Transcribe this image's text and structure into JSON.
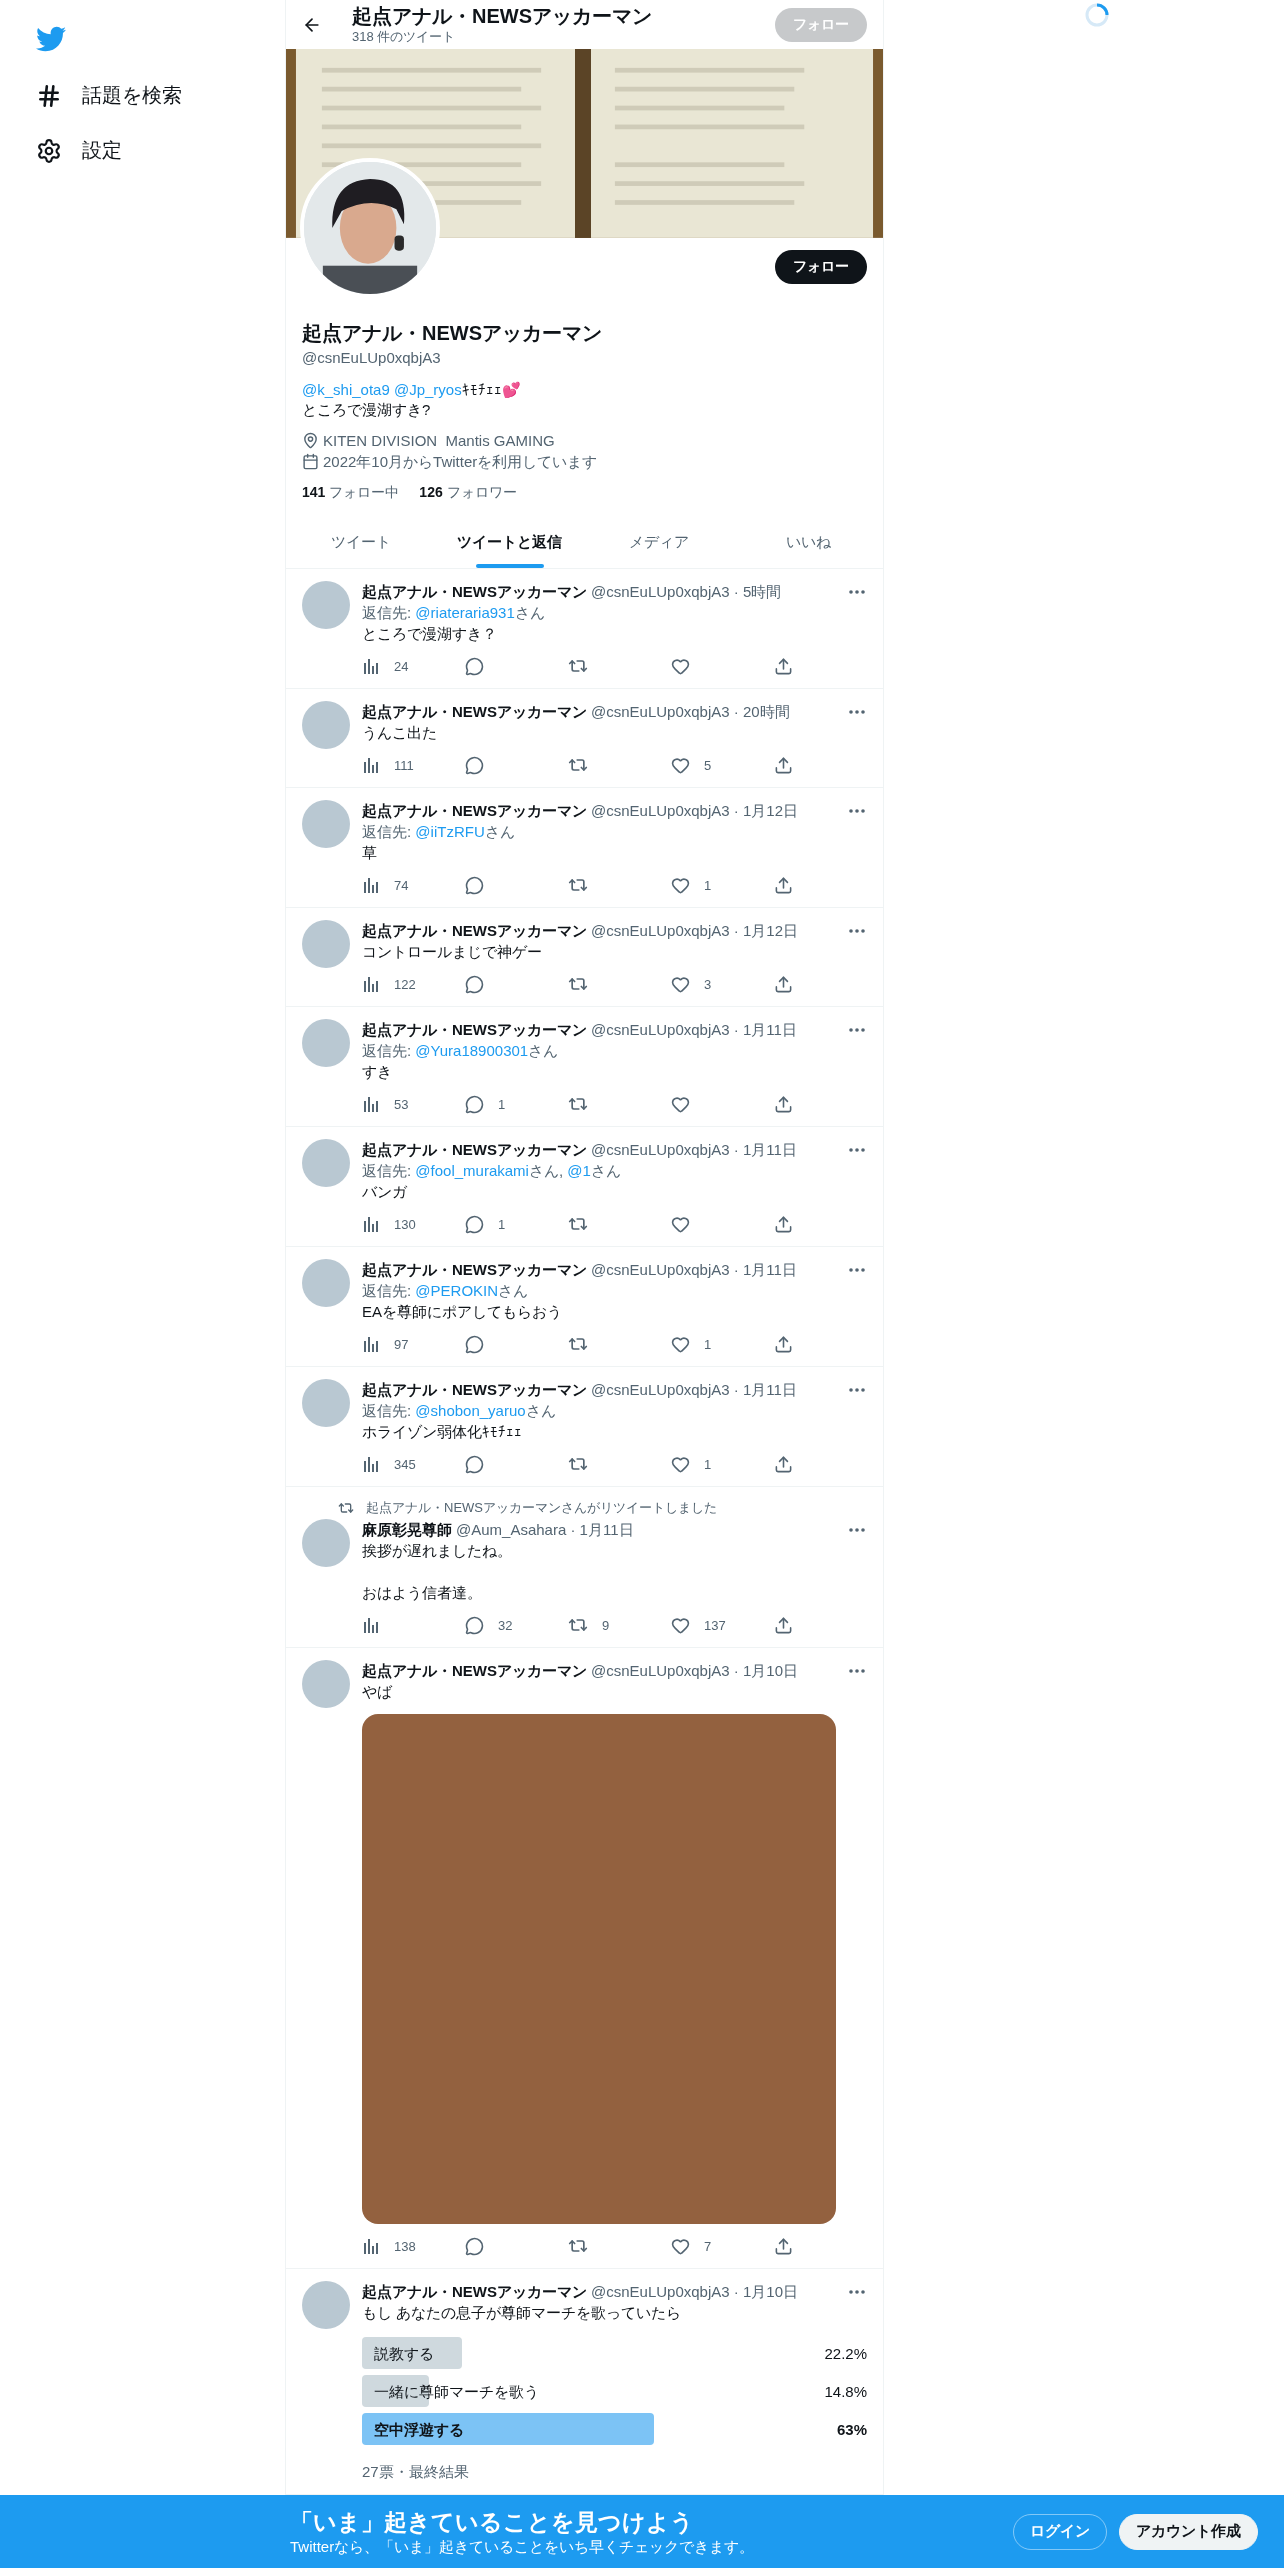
{
  "sidebar": {
    "items": [
      {
        "kind": "explore",
        "label": "話題を検索"
      },
      {
        "kind": "settings",
        "label": "設定"
      }
    ]
  },
  "header": {
    "title": "起点アナル・NEWSアッカーマン",
    "subtitle": "318 件のツイート",
    "follow_button": {
      "label": "フォロー",
      "disabled": true
    }
  },
  "profile": {
    "follow_button": {
      "label": "フォロー",
      "disabled": false
    },
    "name": "起点アナル・NEWSアッカーマン",
    "handle": "@csnEuLUp0xqbjA3",
    "bio": [
      [
        {
          "kind": "mention",
          "text": "@k_shi_ota9"
        },
        {
          "kind": "mention",
          "text": "@Jp_ryos"
        },
        {
          "kind": "text",
          "text": "ｷﾓﾁｪｪ💕"
        }
      ],
      [
        {
          "kind": "text",
          "text": "ところで漫湖すき?"
        }
      ]
    ],
    "location": "KITEN DIVISION  Mantis GAMING",
    "joined": "2022年10月からTwitterを利用しています",
    "stats": [
      {
        "count": "141",
        "label": "フォロー中"
      },
      {
        "count": "126",
        "label": "フォロワー"
      }
    ]
  },
  "tabs": [
    {
      "label": "ツイート",
      "selected": false
    },
    {
      "label": "ツイートと返信",
      "selected": true
    },
    {
      "label": "メディア",
      "selected": false
    },
    {
      "label": "いいね",
      "selected": false
    }
  ],
  "tweets": [
    {
      "author": "起点アナル・NEWSアッカーマン",
      "meta": "@csnEuLUp0xqbjA3 · 5時間",
      "reply_to": [
        {
          "kind": "text",
          "text": "返信先: "
        },
        {
          "kind": "mention",
          "text": "@riateraria931"
        },
        {
          "kind": "text",
          "text": "さん"
        }
      ],
      "text": "ところで漫湖すき？",
      "stats": {
        "views": "24"
      }
    },
    {
      "author": "起点アナル・NEWSアッカーマン",
      "meta": "@csnEuLUp0xqbjA3 · 20時間",
      "text": "うんこ出た",
      "stats": {
        "views": "111",
        "likes": "5"
      }
    },
    {
      "author": "起点アナル・NEWSアッカーマン",
      "meta": "@csnEuLUp0xqbjA3 · 1月12日",
      "reply_to": [
        {
          "kind": "text",
          "text": "返信先: "
        },
        {
          "kind": "mention",
          "text": "@iiTzRFU"
        },
        {
          "kind": "text",
          "text": "さん"
        }
      ],
      "text": "草",
      "stats": {
        "views": "74",
        "likes": "1"
      }
    },
    {
      "author": "起点アナル・NEWSアッカーマン",
      "meta": "@csnEuLUp0xqbjA3 · 1月12日",
      "text": "コントロールまじで神ゲー",
      "stats": {
        "views": "122",
        "likes": "3"
      }
    },
    {
      "author": "起点アナル・NEWSアッカーマン",
      "meta": "@csnEuLUp0xqbjA3 · 1月11日",
      "reply_to": [
        {
          "kind": "text",
          "text": "返信先: "
        },
        {
          "kind": "mention",
          "text": "@Yura18900301"
        },
        {
          "kind": "text",
          "text": "さん"
        }
      ],
      "text": "すき",
      "stats": {
        "views": "53",
        "replies": "1"
      }
    },
    {
      "author": "起点アナル・NEWSアッカーマン",
      "meta": "@csnEuLUp0xqbjA3 · 1月11日",
      "reply_to": [
        {
          "kind": "text",
          "text": "返信先: "
        },
        {
          "kind": "mention",
          "text": "@fool_murakami"
        },
        {
          "kind": "text",
          "text": "さん, "
        },
        {
          "kind": "mention",
          "text": "@1"
        },
        {
          "kind": "text",
          "text": "さん"
        }
      ],
      "text": "バンガ",
      "stats": {
        "views": "130",
        "replies": "1"
      }
    },
    {
      "author": "起点アナル・NEWSアッカーマン",
      "meta": "@csnEuLUp0xqbjA3 · 1月11日",
      "reply_to": [
        {
          "kind": "text",
          "text": "返信先: "
        },
        {
          "kind": "mention",
          "text": "@PEROKIN"
        },
        {
          "kind": "text",
          "text": "さん"
        }
      ],
      "text": "EAを尊師にポアしてもらおう",
      "stats": {
        "views": "97",
        "likes": "1"
      }
    },
    {
      "author": "起点アナル・NEWSアッカーマン",
      "meta": "@csnEuLUp0xqbjA3 · 1月11日",
      "reply_to": [
        {
          "kind": "text",
          "text": "返信先: "
        },
        {
          "kind": "mention",
          "text": "@shobon_yaruo"
        },
        {
          "kind": "text",
          "text": "さん"
        }
      ],
      "text": "ホライゾン弱体化ｷﾓﾁｪｪ",
      "stats": {
        "views": "345",
        "likes": "1"
      }
    },
    {
      "retweeted_by": "起点アナル・NEWSアッカーマンさんがリツイートしました",
      "author": "麻原彰晃尊師",
      "meta": "@Aum_Asahara · 1月11日",
      "text": "挨拶が遅れましたね。",
      "text_2": "おはよう信者達。",
      "stats": {
        "replies": "32",
        "retweets": "9",
        "likes": "137"
      }
    },
    {
      "author": "起点アナル・NEWSアッカーマン",
      "meta": "@csnEuLUp0xqbjA3 · 1月10日",
      "text": "やば",
      "media": true,
      "stats": {
        "views": "138",
        "likes": "7"
      }
    },
    {
      "author": "起点アナル・NEWSアッカーマン",
      "meta": "@csnEuLUp0xqbjA3 · 1月10日",
      "text": "もし あなたの息子が尊師マーチを歌っていたら",
      "poll": {
        "options": [
          {
            "label": "説教する",
            "percent": "22.2%",
            "selected": false
          },
          {
            "label": "一緒に尊師マーチを歌う",
            "percent": "14.8%",
            "selected": false
          },
          {
            "label": "空中浮遊する",
            "percent": "63%",
            "selected": true
          }
        ],
        "footer": "27票・最終結果"
      }
    }
  ],
  "signup_bar": {
    "title": "「いま」起きていることを見つけよう",
    "subtitle": "Twitterなら、「いま」起きていることをいち早くチェックできます。",
    "buttons": [
      {
        "label": "ログイン",
        "kind": "outline"
      },
      {
        "label": "アカウント作成",
        "kind": "filled"
      }
    ]
  }
}
